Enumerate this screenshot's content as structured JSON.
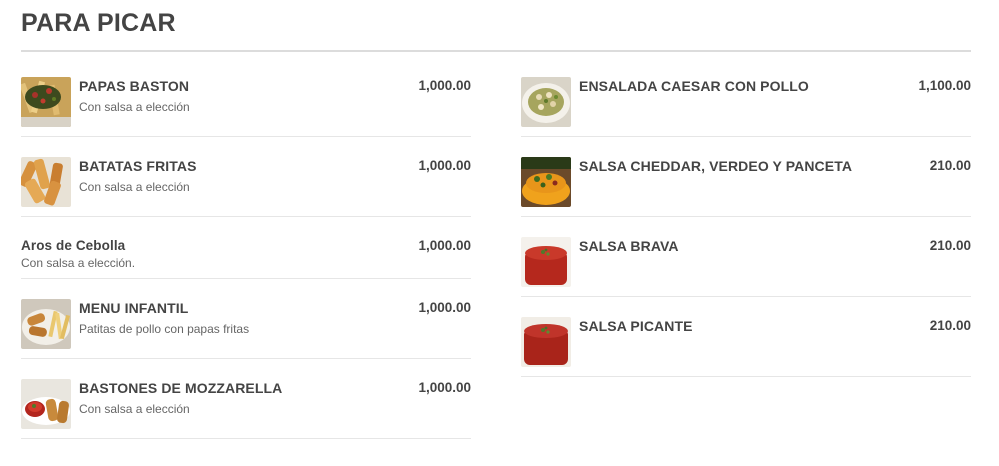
{
  "section": {
    "title": "PARA PICAR"
  },
  "left_items": [
    {
      "name": "PAPAS BASTON",
      "description": "Con salsa a elección",
      "price": "1,000.00",
      "image_icon": "fries-with-toppings-photo"
    },
    {
      "name": "BATATAS FRITAS",
      "description": "Con salsa a elección",
      "price": "1,000.00",
      "image_icon": "sweet-potato-fries-photo"
    },
    {
      "name": "Aros de Cebolla",
      "description": "Con salsa a elección.",
      "price": "1,000.00",
      "image_icon": ""
    },
    {
      "name": "MENU INFANTIL",
      "description": "Patitas de pollo con papas fritas",
      "price": "1,000.00",
      "image_icon": "chicken-fingers-photo"
    },
    {
      "name": "BASTONES DE MOZZARELLA",
      "description": "Con salsa a elección",
      "price": "1,000.00",
      "image_icon": "mozzarella-sticks-photo"
    }
  ],
  "right_items": [
    {
      "name": "ENSALADA CAESAR CON POLLO",
      "description": "",
      "price": "1,100.00",
      "image_icon": "caesar-salad-photo"
    },
    {
      "name": "SALSA CHEDDAR, VERDEO Y PANCETA",
      "description": "",
      "price": "210.00",
      "image_icon": "cheddar-sauce-photo"
    },
    {
      "name": "SALSA BRAVA",
      "description": "",
      "price": "210.00",
      "image_icon": "brava-sauce-photo"
    },
    {
      "name": "SALSA PICANTE",
      "description": "",
      "price": "210.00",
      "image_icon": "spicy-sauce-photo"
    }
  ],
  "colors": {
    "text": "#444444",
    "description": "#666666",
    "divider": "#e6e6e6",
    "title_rule": "#dcdcdc"
  }
}
